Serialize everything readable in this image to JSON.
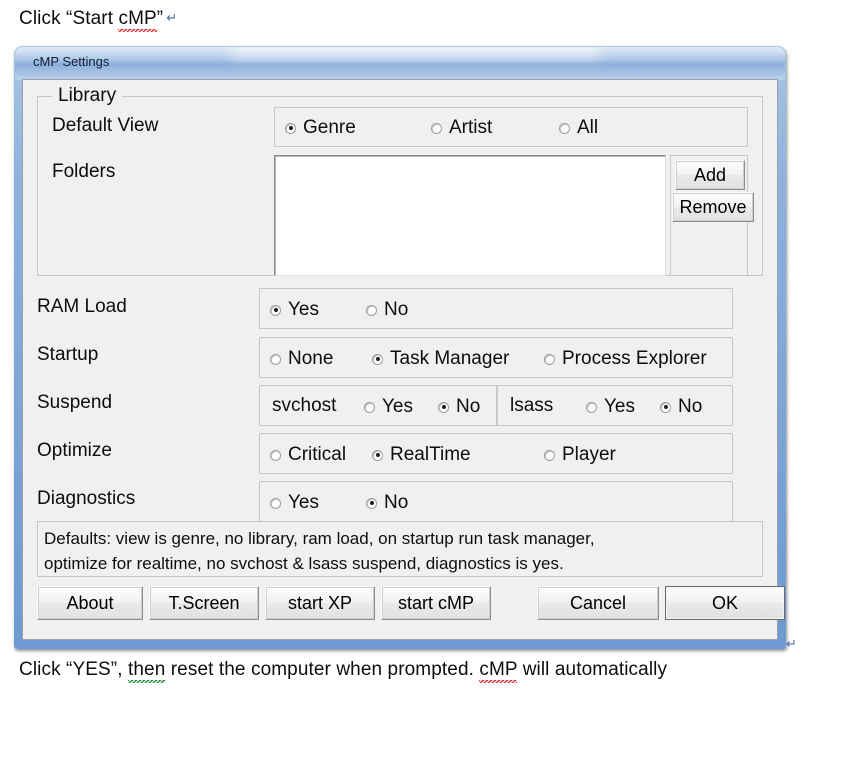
{
  "document": {
    "caption_top_pre": "Click “Start ",
    "caption_top_mis": "cMP",
    "caption_top_post": "”",
    "pilcrow": "↵",
    "caption_bottom_1": "Click “YES”, ",
    "caption_bottom_mis1": "then",
    "caption_bottom_2": " reset the computer when prompted. ",
    "caption_bottom_mis2": "cMP",
    "caption_bottom_3": " will automatically"
  },
  "window": {
    "title": "cMP Settings"
  },
  "library": {
    "legend": "Library",
    "default_view_label": "Default View",
    "default_view_options": [
      {
        "label": "Genre",
        "checked": true
      },
      {
        "label": "Artist",
        "checked": false
      },
      {
        "label": "All",
        "checked": false
      }
    ],
    "folders_label": "Folders",
    "folders_items": [],
    "add_button": "Add",
    "remove_button": "Remove"
  },
  "settings": {
    "ram_load": {
      "label": "RAM Load",
      "options": [
        {
          "label": "Yes",
          "checked": true
        },
        {
          "label": "No",
          "checked": false
        }
      ]
    },
    "startup": {
      "label": "Startup",
      "options": [
        {
          "label": "None",
          "checked": false
        },
        {
          "label": "Task Manager",
          "checked": true
        },
        {
          "label": "Process Explorer",
          "checked": false
        }
      ]
    },
    "suspend": {
      "label": "Suspend",
      "groups": [
        {
          "name": "svchost",
          "options": [
            {
              "label": "Yes",
              "checked": false
            },
            {
              "label": "No",
              "checked": true
            }
          ]
        },
        {
          "name": "lsass",
          "options": [
            {
              "label": "Yes",
              "checked": false
            },
            {
              "label": "No",
              "checked": true
            }
          ]
        }
      ]
    },
    "optimize": {
      "label": "Optimize",
      "options": [
        {
          "label": "Critical",
          "checked": false
        },
        {
          "label": "RealTime",
          "checked": true
        },
        {
          "label": "Player",
          "checked": false
        }
      ]
    },
    "diagnostics": {
      "label": "Diagnostics",
      "options": [
        {
          "label": "Yes",
          "checked": false
        },
        {
          "label": "No",
          "checked": true
        }
      ]
    }
  },
  "defaults_note": {
    "line1": "Defaults: view is genre, no library, ram load, on startup run task manager,",
    "line2": "optimize for realtime, no svchost & lsass suspend, diagnostics is yes."
  },
  "buttons": {
    "about": "About",
    "tscreen": "T.Screen",
    "start_xp": "start XP",
    "start_cmp": "start cMP",
    "cancel": "Cancel",
    "ok": "OK"
  },
  "colors": {
    "titlebar_blue": "#8fb2dd",
    "frame_blue": "#6d9ad2",
    "client_bg": "#f0f0f0",
    "text": "#0d0d0d",
    "spell_red": "#e03030",
    "grammar_green": "#1f8a3b"
  }
}
